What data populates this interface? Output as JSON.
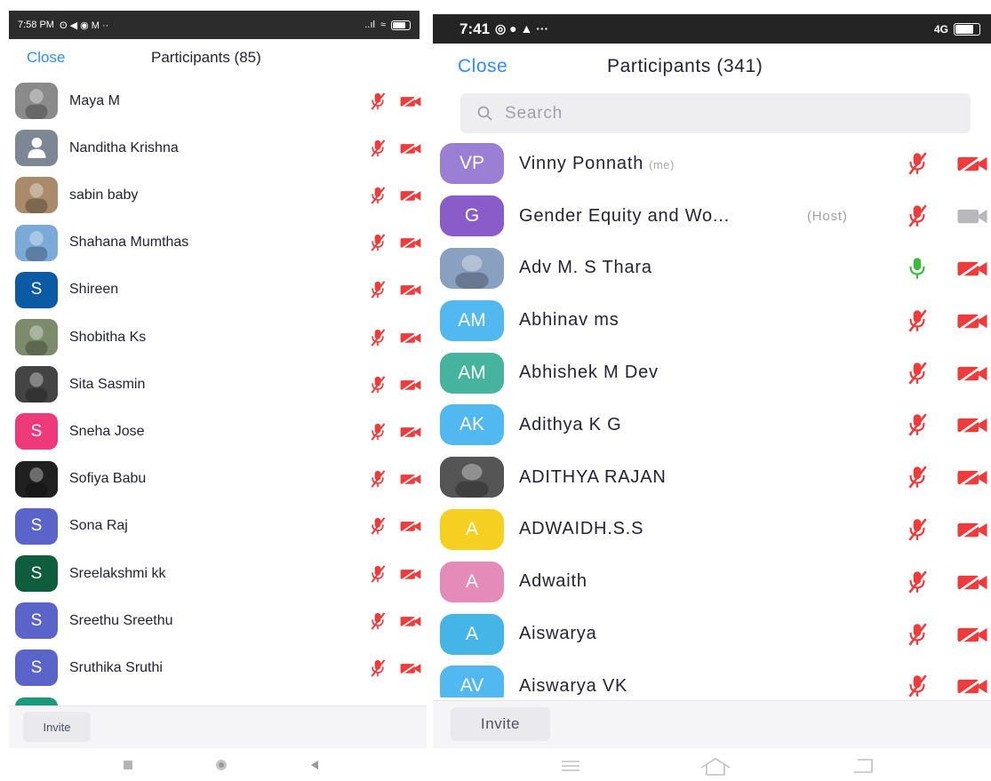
{
  "left": {
    "status": {
      "time": "7:58 PM",
      "extras": "ʘ ◀ ◉ M ··",
      "signal": "..ıl"
    },
    "close_label": "Close",
    "title": "Participants (85)",
    "invite_label": "Invite",
    "participants": [
      {
        "name": "Maya M",
        "avatar": "photo",
        "color": "#8a8a8a"
      },
      {
        "name": "Nanditha Krishna",
        "avatar": "person",
        "color": "#7d8794"
      },
      {
        "name": "sabin baby",
        "avatar": "photo",
        "color": "#a98a6a"
      },
      {
        "name": "Shahana Mumthas",
        "avatar": "photo",
        "color": "#7ba9d8"
      },
      {
        "name": "Shireen",
        "initials": "S",
        "color": "#0b5aa3"
      },
      {
        "name": "Shobitha Ks",
        "avatar": "photo",
        "color": "#7b8b6b"
      },
      {
        "name": "Sita Sasmin",
        "avatar": "photo",
        "color": "#444444"
      },
      {
        "name": "Sneha Jose",
        "initials": "S",
        "color": "#ee3a7a"
      },
      {
        "name": "Sofiya Babu",
        "avatar": "photo",
        "color": "#202020"
      },
      {
        "name": "Sona Raj",
        "initials": "S",
        "color": "#5b65c9"
      },
      {
        "name": "Sreelakshmi kk",
        "initials": "S",
        "color": "#0f5d3f"
      },
      {
        "name": "Sreethu Sreethu",
        "initials": "S",
        "color": "#5b65c9"
      },
      {
        "name": "Sruthika Sruthi",
        "initials": "S",
        "color": "#5b65c9"
      },
      {
        "name": "",
        "initials": "",
        "color": "#1a9a7a"
      }
    ]
  },
  "right": {
    "status": {
      "time": "7:41",
      "signal": "4G"
    },
    "close_label": "Close",
    "title": "Participants (341)",
    "search_placeholder": "Search",
    "invite_label": "Invite",
    "participants": [
      {
        "name": "Vinny Ponnath",
        "tag": "(me)",
        "initials": "VP",
        "color": "#9b7fd4"
      },
      {
        "name": "Gender Equity and Wo...",
        "host": "(Host)",
        "initials": "G",
        "color": "#8a5cc9",
        "cam": "gray"
      },
      {
        "name": "Adv M. S Thara",
        "avatar": "photo",
        "color": "#8aa0c0",
        "mic": "green"
      },
      {
        "name": "Abhinav ms",
        "initials": "AM",
        "color": "#52b8f0"
      },
      {
        "name": "Abhishek M Dev",
        "initials": "AM",
        "color": "#45b39d"
      },
      {
        "name": "Adithya K G",
        "initials": "AK",
        "color": "#52b8f0"
      },
      {
        "name": "ADITHYA RAJAN",
        "avatar": "photo",
        "color": "#555555"
      },
      {
        "name": "ADWAIDH.S.S",
        "initials": "A",
        "color": "#f5d020"
      },
      {
        "name": "Adwaith",
        "initials": "A",
        "color": "#e58bb9"
      },
      {
        "name": "Aiswarya",
        "initials": "A",
        "color": "#45b5e8"
      },
      {
        "name": "Aiswarya VK",
        "initials": "AV",
        "color": "#52b8f0"
      }
    ]
  },
  "colors": {
    "accent": "#2d8cff",
    "muted_icon": "#ef3b3b",
    "mic_on": "#3dbb3d",
    "cam_gray": "#b8b8bc"
  },
  "icons": {
    "mic": "mic-muted-icon",
    "cam": "video-off-icon",
    "search": "search-icon"
  }
}
